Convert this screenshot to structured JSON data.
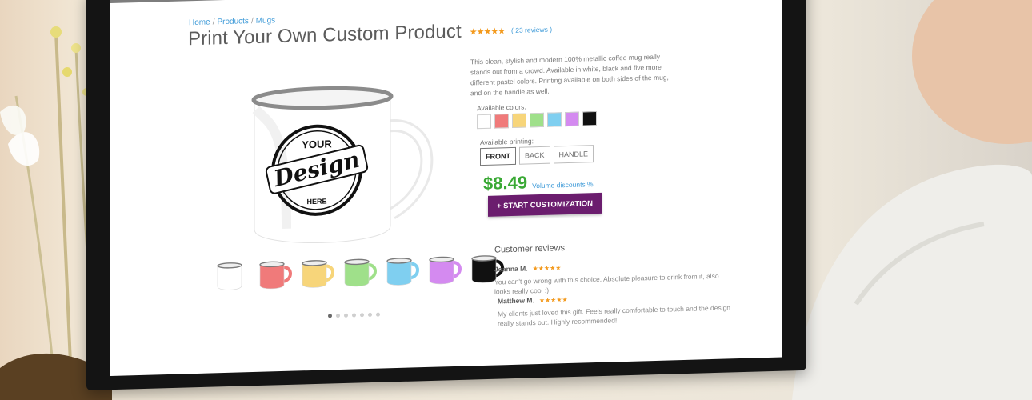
{
  "breadcrumb": {
    "items": [
      "Home",
      "Products",
      "Mugs"
    ],
    "separator": "/"
  },
  "product": {
    "title": "Print Your Own Custom Product",
    "rating_stars": "★★★★★",
    "reviews_link": "( 23 reviews )",
    "description": "This clean, stylish and modern 100% metallic coffee mug really stands out from a crowd. Available in white, black and five more different pastel colors. Printing available on both sides of the mug, and on the handle as well.",
    "mug_design_text": {
      "top": "YOUR",
      "middle": "Design",
      "bottom": "HERE"
    }
  },
  "colors": {
    "label": "Available colors:",
    "options": [
      "#ffffff",
      "#f07a7a",
      "#f7d57a",
      "#9fe08a",
      "#7fcff0",
      "#d48af0",
      "#111111"
    ]
  },
  "printing": {
    "label": "Available printing:",
    "options": [
      "FRONT",
      "BACK",
      "HANDLE"
    ],
    "selected": "FRONT"
  },
  "price": {
    "amount": "$8.49",
    "volume_link": "Volume discounts %"
  },
  "cta": {
    "label": "+ START CUSTOMIZATION"
  },
  "gallery": {
    "thumbnail_colors": [
      "#ffffff",
      "#f07a7a",
      "#f7d57a",
      "#9fe08a",
      "#7fcff0",
      "#d48af0",
      "#111111"
    ],
    "dot_count": 7,
    "active_dot": 0
  },
  "reviews": {
    "title": "Customer reviews:",
    "items": [
      {
        "name": "Joanna M.",
        "stars": "★★★★★",
        "text": "You can't go wrong with this choice. Absolute pleasure to drink from it, also looks really cool :)"
      },
      {
        "name": "Matthew M.",
        "stars": "★★★★★",
        "text": "My clients just loved this gift. Feels really comfortable to touch and the design really stands out. Highly recommended!"
      }
    ]
  },
  "theme": {
    "accent": "#6b1d6e",
    "price": "#3aa935",
    "link": "#3d9ad8",
    "star": "#f39a1e"
  }
}
